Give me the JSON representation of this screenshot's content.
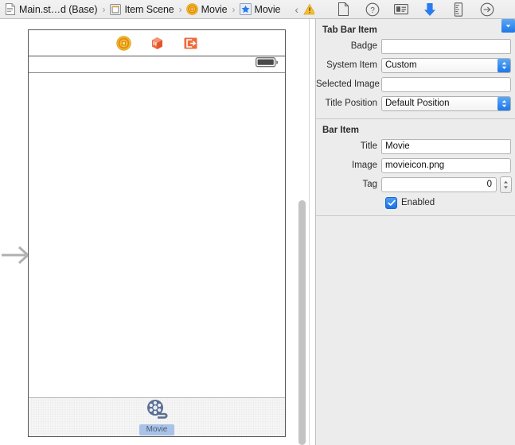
{
  "jump_bar": {
    "items": [
      {
        "icon": "storyboard-file-icon",
        "label": "Main.st…d (Base)"
      },
      {
        "icon": "scene-icon",
        "label": "Item Scene"
      },
      {
        "icon": "view-controller-icon",
        "label": "Movie"
      },
      {
        "icon": "tab-bar-item-icon",
        "label": "Movie"
      }
    ],
    "separator": "›",
    "back_arrow": "‹",
    "forward_arrow": "›",
    "warning_icon": "warning-triangle-icon"
  },
  "inspector_toolbar": {
    "tabs": [
      {
        "name": "file-inspector",
        "icon": "document-icon",
        "selected": false
      },
      {
        "name": "quick-help-inspector",
        "icon": "question-mark-icon",
        "selected": false
      },
      {
        "name": "identity-inspector",
        "icon": "id-card-icon",
        "selected": false
      },
      {
        "name": "attributes-inspector",
        "icon": "down-arrow-icon",
        "selected": true
      },
      {
        "name": "size-inspector",
        "icon": "ruler-icon",
        "selected": false
      },
      {
        "name": "connections-inspector",
        "icon": "arrow-circle-icon",
        "selected": false
      }
    ],
    "selected_color": "#2a7bef"
  },
  "canvas": {
    "entry_point_arrow": "storyboard-entry-point-arrow",
    "scene_dock": [
      {
        "name": "view-controller-dock-icon",
        "icon": "view-controller-icon"
      },
      {
        "name": "first-responder-dock-icon",
        "icon": "first-responder-cube-icon"
      },
      {
        "name": "exit-dock-icon",
        "icon": "exit-icon"
      }
    ],
    "status_bar": {
      "battery_icon": "battery-icon"
    },
    "tab_bar": {
      "items": [
        {
          "icon": "film-reel-icon",
          "label": "Movie",
          "selected": true
        }
      ]
    }
  },
  "inspector": {
    "sections": [
      {
        "title": "Tab Bar Item",
        "rows": [
          {
            "label": "Badge",
            "control": "text",
            "value": "",
            "placeholder": ""
          },
          {
            "label": "System Item",
            "control": "popup",
            "value": "Custom"
          },
          {
            "label": "Selected Image",
            "control": "combo",
            "value": "",
            "placeholder": ""
          },
          {
            "label": "Title Position",
            "control": "popup",
            "value": "Default Position"
          }
        ]
      },
      {
        "title": "Bar Item",
        "rows": [
          {
            "label": "Title",
            "control": "text",
            "value": "Movie",
            "placeholder": ""
          },
          {
            "label": "Image",
            "control": "combo",
            "value": "movieicon.png"
          },
          {
            "label": "Tag",
            "control": "stepper",
            "value": "0"
          },
          {
            "label": "Enabled",
            "control": "checkbox",
            "value": "Enabled",
            "checked": true
          }
        ]
      }
    ]
  }
}
